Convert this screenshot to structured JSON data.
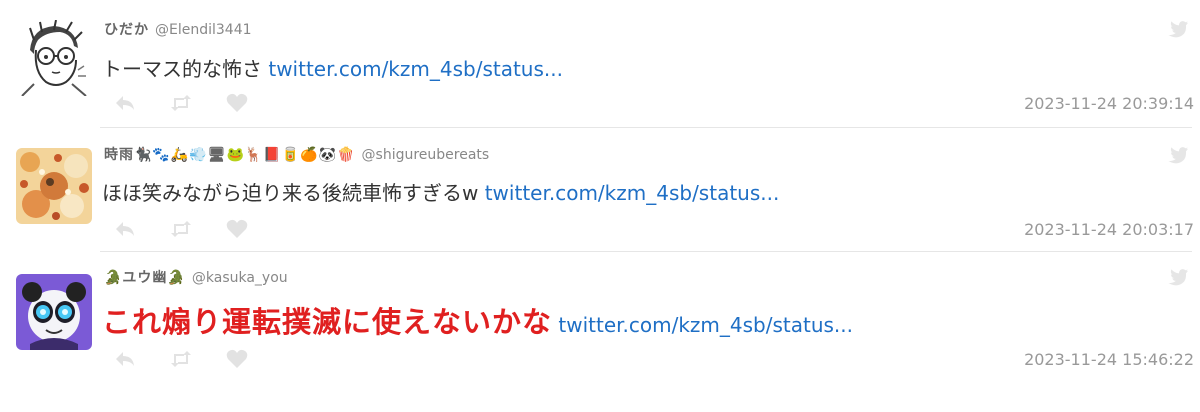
{
  "tweets": [
    {
      "display_name": "ひだか",
      "handle": "@Elendil3441",
      "text": "トーマス的な怖さ",
      "link": "twitter.com/kzm_4sb/status...",
      "timestamp": "2023-11-24 20:39:14",
      "avatar": "sketch-avatar"
    },
    {
      "display_name": "時雨🐈‍⬛🐾🛵💨🖥🐸🦌📕🥫🍊🐼🍿",
      "handle": "@shigureubereats",
      "text": "ほほ笑みながら迫り来る後続車怖すぎるw",
      "link": "twitter.com/kzm_4sb/status...",
      "timestamp": "2023-11-24 20:03:17",
      "avatar": "food-avatar"
    },
    {
      "display_name": "🐊ユウ幽🐊",
      "handle": "@kasuka_you",
      "text": "これ煽り運転撲滅に使えないかな",
      "link": "twitter.com/kzm_4sb/status...",
      "timestamp": "2023-11-24 15:46:22",
      "avatar": "panda-avatar"
    }
  ],
  "icons": {
    "reply": "reply-icon",
    "retweet": "retweet-icon",
    "like": "heart-icon",
    "brand": "bird-icon"
  },
  "colors": {
    "link": "#1f6fc5",
    "emphasis": "#e02020",
    "muted": "#999999"
  }
}
